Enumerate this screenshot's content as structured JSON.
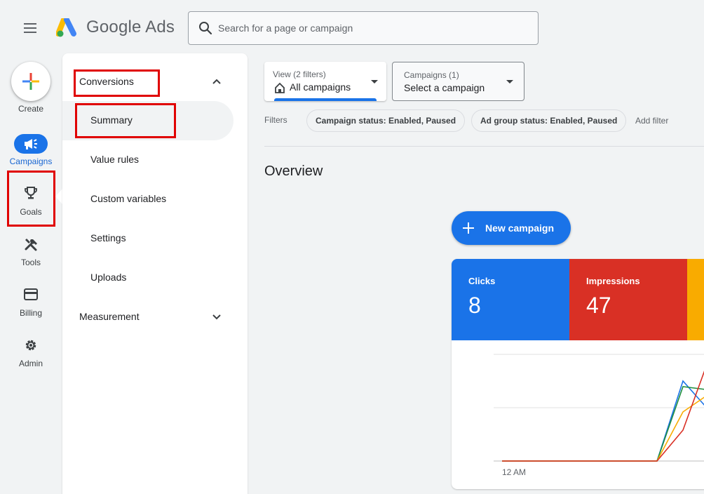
{
  "header": {
    "brand": "Google Ads",
    "search_placeholder": "Search for a page or campaign"
  },
  "rail": {
    "create": "Create",
    "items": [
      {
        "label": "Campaigns",
        "icon": "megaphone-icon"
      },
      {
        "label": "Goals",
        "icon": "trophy-icon"
      },
      {
        "label": "Tools",
        "icon": "tools-icon"
      },
      {
        "label": "Billing",
        "icon": "credit-card-icon"
      },
      {
        "label": "Admin",
        "icon": "gear-icon"
      }
    ]
  },
  "subnav": {
    "conversions": "Conversions",
    "summary": "Summary",
    "value_rules": "Value rules",
    "custom_variables": "Custom variables",
    "settings": "Settings",
    "uploads": "Uploads",
    "measurement": "Measurement"
  },
  "filters_bar": {
    "view_small": "View (2 filters)",
    "view_value": "All campaigns",
    "campaigns_small": "Campaigns (1)",
    "campaigns_value": "Select a campaign",
    "filters_label": "Filters",
    "chip_campaign_status": "Campaign status: Enabled, Paused",
    "chip_adgroup_status": "Ad group status: Enabled, Paused",
    "add_filter": "Add filter"
  },
  "overview": {
    "title": "Overview",
    "new_campaign": "New campaign",
    "metrics": [
      {
        "name": "Clicks",
        "value": "8",
        "color": "#1a73e8"
      },
      {
        "name": "Impressions",
        "value": "47",
        "color": "#d93025"
      },
      {
        "name": "",
        "value": "",
        "color": "#f9ab00"
      }
    ],
    "chart_x_label": "12 AM"
  },
  "colors": {
    "accent": "#1a73e8",
    "highlight_box": "#e00000"
  }
}
